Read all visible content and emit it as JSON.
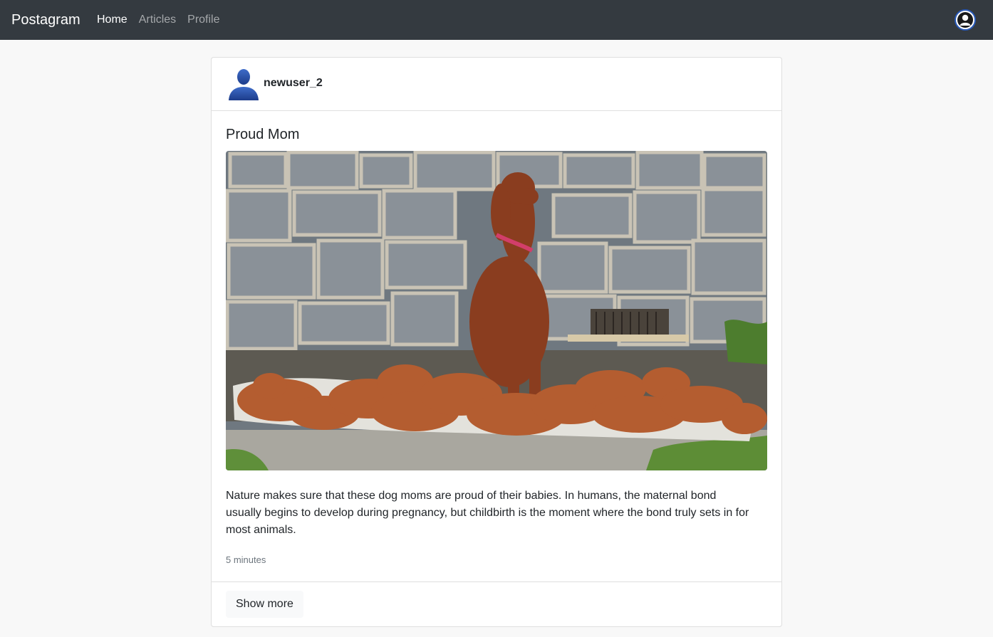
{
  "navbar": {
    "brand": "Postagram",
    "links": [
      {
        "label": "Home",
        "active": true
      },
      {
        "label": "Articles",
        "active": false
      },
      {
        "label": "Profile",
        "active": false
      }
    ],
    "avatar_icon": "user-avatar-icon"
  },
  "post": {
    "author": "newuser_2",
    "author_avatar_icon": "user-silhouette-icon",
    "title": "Proud Mom",
    "image_icon": "dog-with-puppies-photo",
    "body": "Nature makes sure that these dog moms are proud of their babies. In humans, the maternal bond usually begins to develop during pregnancy, but childbirth is the moment where the bond truly sets in for most animals.",
    "timestamp": "5 minutes",
    "show_more_label": "Show more"
  },
  "colors": {
    "navbar_bg": "#343a40",
    "page_bg": "#f8f8f8",
    "card_bg": "#ffffff",
    "avatar_blue": "#2a4fa0"
  }
}
